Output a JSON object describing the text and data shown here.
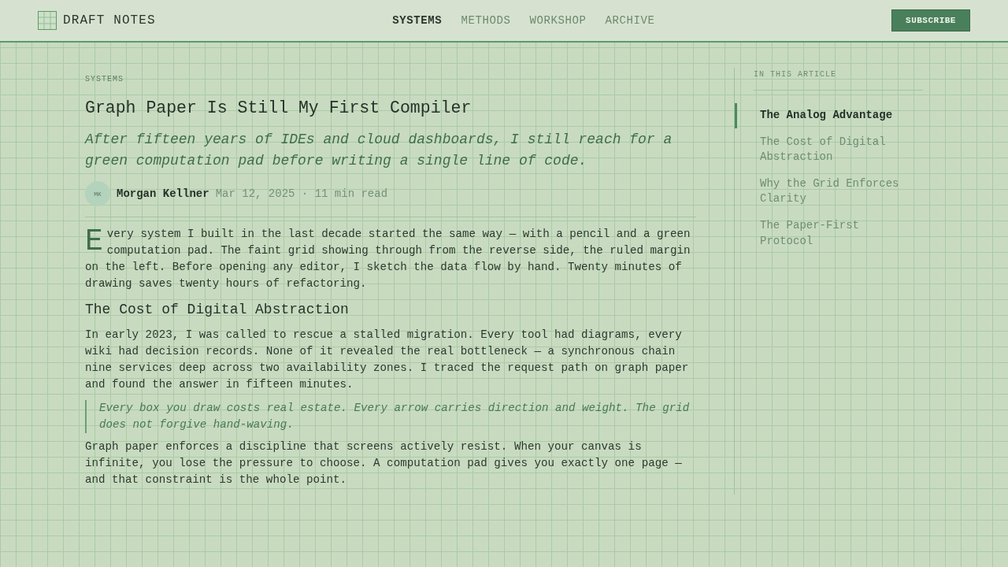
{
  "header": {
    "logo": {
      "text": "DRAFT NOTES"
    },
    "nav": [
      {
        "label": "SYSTEMS",
        "selected": true
      },
      {
        "label": "METHODS",
        "selected": false
      },
      {
        "label": "WORKSHOP",
        "selected": false
      },
      {
        "label": "ARCHIVE",
        "selected": false
      }
    ],
    "subscribe_button": "SUBSCRIBE"
  },
  "article": {
    "category": "SYSTEMS",
    "title": "Graph Paper Is Still My First Compiler",
    "subtitle": "After fifteen years of IDEs and cloud dashboards, I still reach for a green computation pad before writing a single line of code.",
    "author": {
      "initials": "MK",
      "name": "Morgan Kellner"
    },
    "meta": "Mar 12, 2025 · 11 min read",
    "blocks": [
      {
        "kind": "paragraph",
        "drop_cap": true,
        "text": "Every system I built in the last decade started the same way — with a pencil and a green computation pad. The faint grid showing through from the reverse side, the ruled margin on the left. Before opening any editor, I sketch the data flow by hand. Twenty minutes of drawing saves twenty hours of refactoring."
      },
      {
        "kind": "heading",
        "text": "The Cost of Digital Abstraction"
      },
      {
        "kind": "paragraph",
        "drop_cap": false,
        "text": "In early 2023, I was called to rescue a stalled migration. Every tool had diagrams, every wiki had decision records. None of it revealed the real bottleneck — a synchronous chain nine services deep across two availability zones. I traced the request path on graph paper and found the answer in fifteen minutes."
      },
      {
        "kind": "quote",
        "text": "Every box you draw costs real estate. Every arrow carries direction and weight. The grid does not forgive hand-waving."
      },
      {
        "kind": "paragraph",
        "drop_cap": false,
        "text": "Graph paper enforces a discipline that screens actively resist. When your canvas is infinite, you lose the pressure to choose. A computation pad gives you exactly one page — and that constraint is the whole point."
      }
    ]
  },
  "toc": {
    "heading": "IN THIS ARTICLE",
    "items": [
      {
        "label": "The Analog Advantage",
        "selected": true
      },
      {
        "label": "The Cost of Digital Abstraction",
        "selected": false
      },
      {
        "label": "Why the Grid Enforces Clarity",
        "selected": false
      },
      {
        "label": "The Paper-First Protocol",
        "selected": false
      }
    ]
  }
}
